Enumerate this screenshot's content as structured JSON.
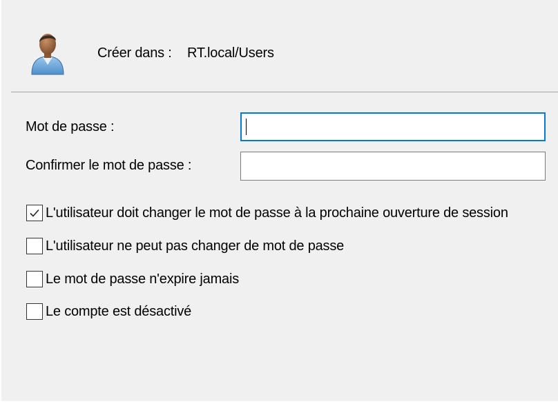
{
  "header": {
    "icon": "user-icon",
    "create_in_label": "Créer dans :",
    "create_in_path": "RT.local/Users"
  },
  "form": {
    "password": {
      "label": "Mot de passe :",
      "value": "",
      "focused": true
    },
    "confirm_password": {
      "label": "Confirmer le mot de passe :",
      "value": ""
    }
  },
  "options": [
    {
      "label": "L'utilisateur doit changer le mot de passe à la prochaine ouverture de session",
      "checked": true
    },
    {
      "label": "L'utilisateur ne peut pas changer de mot de passe",
      "checked": false
    },
    {
      "label": "Le mot de passe n'expire jamais",
      "checked": false
    },
    {
      "label": "Le compte est désactivé",
      "checked": false
    }
  ],
  "colors": {
    "dialog_background": "#f0f0f0",
    "focus_border": "#0078d7",
    "input_border": "#7a7a7a",
    "separator": "#a0a0a0"
  }
}
